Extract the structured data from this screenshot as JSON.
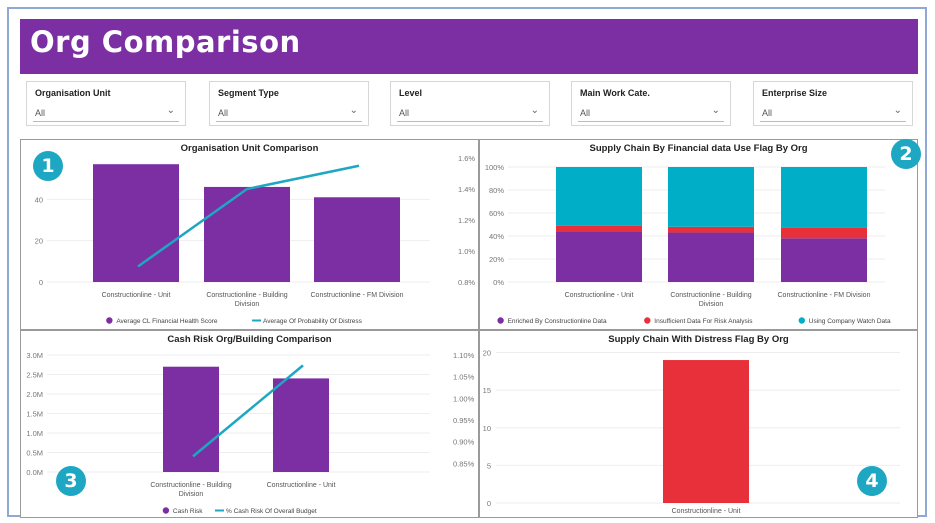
{
  "page": {
    "title": "Org Comparison"
  },
  "filters": [
    {
      "label": "Organisation Unit",
      "value": "All"
    },
    {
      "label": "Segment Type",
      "value": "All"
    },
    {
      "label": "Level",
      "value": "All"
    },
    {
      "label": "Main Work Cate.",
      "value": "All"
    },
    {
      "label": "Enterprise Size",
      "value": "All"
    }
  ],
  "badges": [
    "1",
    "2",
    "3",
    "4"
  ],
  "colors": {
    "purple": "#7b2fa3",
    "teal": "#1ea7c2",
    "red": "#e8303b",
    "cyan": "#00aec7"
  },
  "chart_data": [
    {
      "id": "org-unit",
      "type": "bar",
      "title": "Organisation Unit Comparison",
      "categories": [
        [
          "Constructionline - Unit"
        ],
        [
          "Constructionline - Building",
          "Division"
        ],
        [
          "Constructionline - FM Division"
        ]
      ],
      "series": [
        {
          "name": "Average CL Financial Health Score",
          "kind": "bar",
          "axis": "left",
          "values": [
            57,
            46,
            41
          ]
        },
        {
          "name": "Average Of Probability Of Distress",
          "kind": "line",
          "axis": "right",
          "values": [
            0.9,
            1.4,
            1.55
          ]
        }
      ],
      "ylim": [
        0,
        60
      ],
      "yticks": [
        0,
        20,
        40
      ],
      "ytick_labels": [
        "0",
        "20",
        "40"
      ],
      "y2lim": [
        0.8,
        1.6
      ],
      "y2ticks": [
        0.8,
        1.0,
        1.2,
        1.4,
        1.6
      ],
      "y2tick_labels": [
        "0.8%",
        "1.0%",
        "1.2%",
        "1.4%",
        "1.6%"
      ]
    },
    {
      "id": "supply-financial",
      "type": "bar",
      "stacked": true,
      "title": "Supply Chain By Financial data Use Flag By Org",
      "categories": [
        [
          "Constructionline - Unit"
        ],
        [
          "Constructionline - Building",
          "Division"
        ],
        [
          "Constructionline - FM Division"
        ]
      ],
      "series": [
        {
          "name": "Enriched By Constructionline Data",
          "color": "#7b2fa3",
          "values": [
            44,
            43,
            38
          ]
        },
        {
          "name": "Insufficient Data For Risk Analysis",
          "color": "#e8303b",
          "values": [
            5,
            5,
            9
          ]
        },
        {
          "name": "Using Company Watch Data",
          "color": "#00aec7",
          "values": [
            51,
            52,
            53
          ]
        }
      ],
      "ylim": [
        0,
        100
      ],
      "yticks": [
        0,
        20,
        40,
        60,
        80,
        100
      ],
      "ytick_labels": [
        "0%",
        "20%",
        "40%",
        "60%",
        "80%",
        "100%"
      ]
    },
    {
      "id": "cash-risk",
      "type": "bar",
      "title": "Cash Risk Org/Building Comparison",
      "categories": [
        [
          "Constructionline - Building",
          "Division"
        ],
        [
          "Constructionline - Unit"
        ]
      ],
      "series": [
        {
          "name": "Cash Risk",
          "kind": "bar",
          "axis": "left",
          "values": [
            2.7,
            2.4
          ]
        },
        {
          "name": "% Cash Risk Of Overall Budget",
          "kind": "line",
          "axis": "right",
          "values": [
            0.866,
            1.076
          ]
        }
      ],
      "ylim": [
        0,
        3.0
      ],
      "yticks": [
        0,
        0.5,
        1.0,
        1.5,
        2.0,
        2.5,
        3.0
      ],
      "ytick_labels": [
        "0.0M",
        "0.5M",
        "1.0M",
        "1.5M",
        "2.0M",
        "2.5M",
        "3.0M"
      ],
      "y2lim": [
        0.83,
        1.1
      ],
      "y2ticks": [
        0.85,
        0.9,
        0.95,
        1.0,
        1.05,
        1.1
      ],
      "y2tick_labels": [
        "0.85%",
        "0.90%",
        "0.95%",
        "1.00%",
        "1.05%",
        "1.10%"
      ]
    },
    {
      "id": "distress",
      "type": "bar",
      "title": "Supply Chain With Distress Flag By Org",
      "categories": [
        [
          "Constructionline - Unit"
        ]
      ],
      "series": [
        {
          "name": "",
          "color": "#e8303b",
          "values": [
            19
          ]
        }
      ],
      "ylim": [
        0,
        21
      ],
      "yticks": [
        0,
        5,
        10,
        15,
        20
      ],
      "ytick_labels": [
        "0",
        "5",
        "10",
        "15",
        "20"
      ]
    }
  ]
}
